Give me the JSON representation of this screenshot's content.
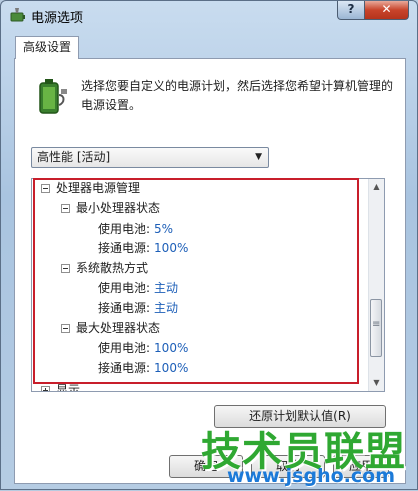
{
  "window": {
    "title": "电源选项"
  },
  "caption": {
    "help": "?",
    "close": "✕"
  },
  "tabs": [
    {
      "label": "高级设置"
    }
  ],
  "intro": "选择您要自定义的电源计划，然后选择您希望计算机管理的电源设置。",
  "plan_select": {
    "value": "高性能 [活动]"
  },
  "tree": {
    "processor_group": "处理器电源管理",
    "min_state": {
      "label": "最小处理器状态",
      "battery_label": "使用电池:",
      "battery_value": "5%",
      "ac_label": "接通电源:",
      "ac_value": "100%"
    },
    "cooling": {
      "label": "系统散热方式",
      "battery_label": "使用电池:",
      "battery_value": "主动",
      "ac_label": "接通电源:",
      "ac_value": "主动"
    },
    "max_state": {
      "label": "最大处理器状态",
      "battery_label": "使用电池:",
      "battery_value": "100%",
      "ac_label": "接通电源:",
      "ac_value": "100%"
    },
    "display_group": "显示"
  },
  "buttons": {
    "restore": "还原计划默认值(R)",
    "ok": "确定",
    "cancel": "取消",
    "apply": "应用"
  },
  "watermark": {
    "text": "技术员联盟",
    "url": "www.jsgho.com"
  },
  "colors": {
    "highlight": "#c81e2b",
    "value": "#1d5fb8",
    "watermark": "#2fa832"
  }
}
